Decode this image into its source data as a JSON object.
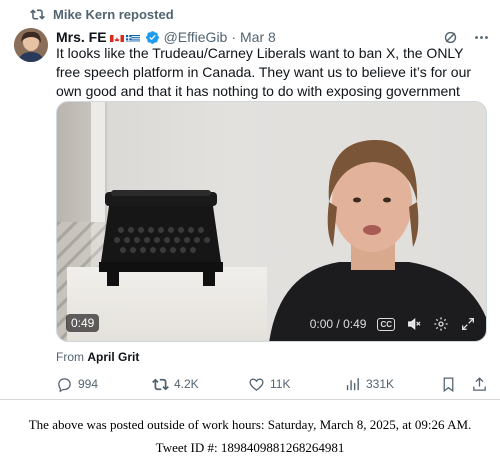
{
  "repost": {
    "label": "Mike Kern reposted",
    "icon": "repost-icon"
  },
  "author": {
    "display_name": "Mrs. FE",
    "flags": [
      "canada-flag",
      "greece-flag"
    ],
    "verified": true,
    "handle": "@EffieGib",
    "separator": "·",
    "date": "Mar 8"
  },
  "tweet": {
    "text": "It looks like the Trudeau/Carney Liberals want to ban X, the ONLY free speech platform in Canada. They want us to believe it’s for our own good and that it has nothing to do with exposing government corruption!"
  },
  "video": {
    "duration_badge": "0:49",
    "time_display": "0:00 / 0:49",
    "cc_label": "CC"
  },
  "source": {
    "prefix": "From",
    "name": "April Grit"
  },
  "actions": {
    "replies": "994",
    "reposts": "4.2K",
    "likes": "11K",
    "views": "331K"
  },
  "colors": {
    "text": "#0f1419",
    "muted": "#536471",
    "verified": "#1d9bf0"
  },
  "caption": {
    "line1": "The above was posted outside of work hours: Saturday, March 8, 2025, at 09:26 AM.",
    "line2": "Tweet ID #: 1898409881268264981"
  }
}
